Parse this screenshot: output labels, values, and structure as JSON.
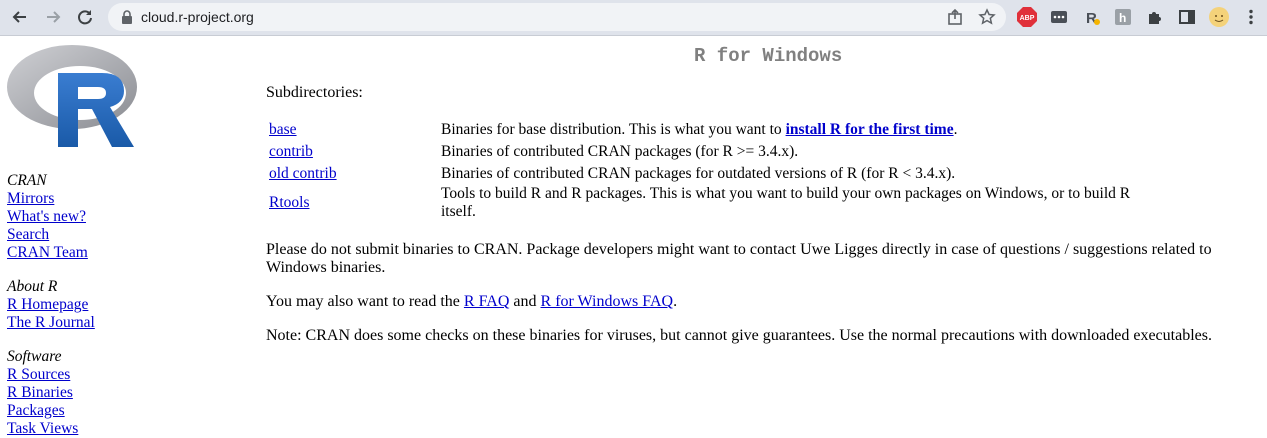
{
  "browser": {
    "url": "cloud.r-project.org"
  },
  "page": {
    "title": "R for Windows",
    "subdirectories_label": "Subdirectories:",
    "rows": [
      {
        "dir": "base",
        "desc_before": "Binaries for base distribution. This is what you want to ",
        "desc_link": "install R for the first time",
        "desc_after": "."
      },
      {
        "dir": "contrib",
        "desc": "Binaries of contributed CRAN packages (for R >= 3.4.x)."
      },
      {
        "dir": "old contrib",
        "desc": "Binaries of contributed CRAN packages for outdated versions of R (for R < 3.4.x)."
      },
      {
        "dir": "Rtools",
        "desc": "Tools to build R and R packages. This is what you want to build your own packages on Windows, or to build R itself."
      }
    ],
    "para1": "Please do not submit binaries to CRAN. Package developers might want to contact Uwe Ligges directly in case of questions / suggestions related to Windows binaries.",
    "para2_before": "You may also want to read the ",
    "para2_link1": "R FAQ",
    "para2_mid": " and ",
    "para2_link2": "R for Windows FAQ",
    "para2_after": ".",
    "para3": "Note: CRAN does some checks on these binaries for viruses, but cannot give guarantees. Use the normal precautions with downloaded executables."
  },
  "sidebar": {
    "cran_header": "CRAN",
    "cran_links": [
      "Mirrors",
      "What's new?",
      "Search",
      "CRAN Team"
    ],
    "about_header": "About R",
    "about_links": [
      "R Homepage",
      "The R Journal"
    ],
    "software_header": "Software",
    "software_links": [
      "R Sources",
      "R Binaries",
      "Packages",
      "Task Views"
    ]
  },
  "icons": {
    "back": "arrow-left-icon",
    "forward": "arrow-right-icon",
    "reload": "reload-icon",
    "lock": "lock-icon",
    "share": "share-icon",
    "bookmark": "star-icon",
    "adblock": "abp-icon",
    "extensions": "puzzle-icon",
    "sidepanel": "side-panel-icon",
    "profile": "avatar-icon",
    "menu": "kebab-menu-icon"
  },
  "colors": {
    "link": "#0000cc",
    "title": "#808080",
    "chrome": "#dfe3eb"
  }
}
